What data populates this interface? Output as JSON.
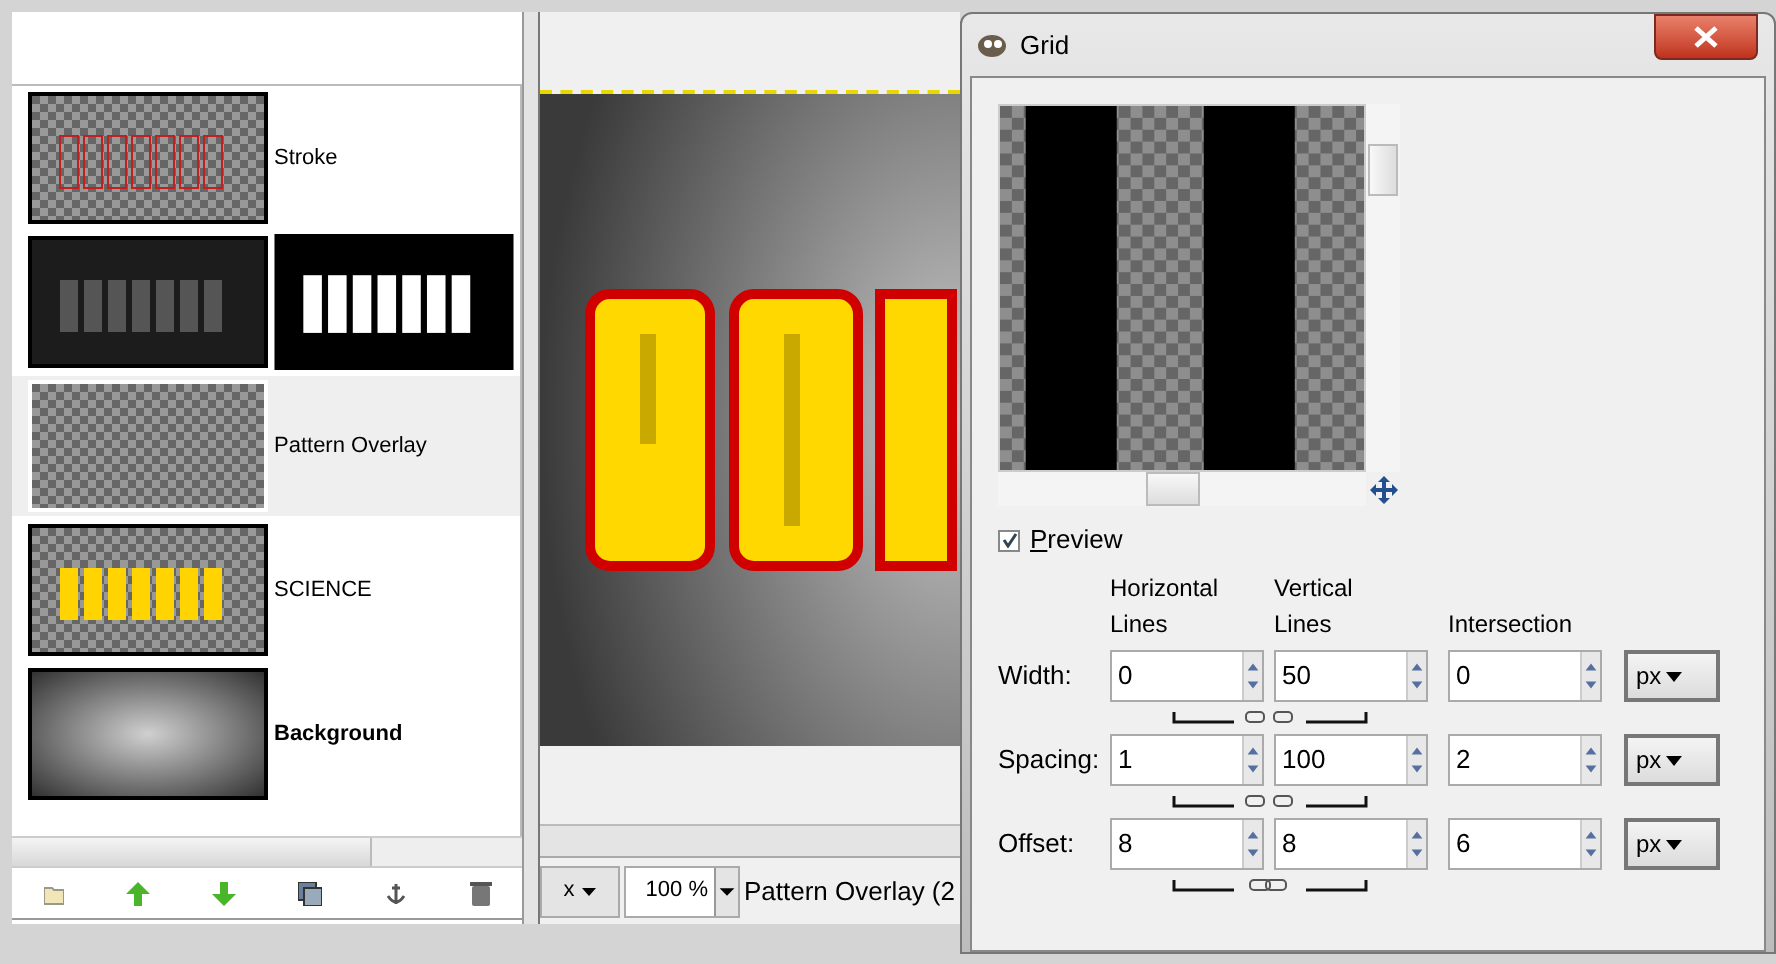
{
  "layers": [
    {
      "name": "Stroke",
      "kind": "stroke",
      "selected": false
    },
    {
      "kind": "effect",
      "selected": false
    },
    {
      "name": "Pattern Overlay",
      "kind": "pattern",
      "selected": true
    },
    {
      "name": "SCIENCE",
      "kind": "text",
      "selected": false
    },
    {
      "name": "Background",
      "kind": "gradient",
      "selected": false,
      "emphasized": true
    }
  ],
  "status_bar": {
    "unit": "x",
    "zoom": "100 %",
    "message": "Pattern Overlay (2"
  },
  "dialog": {
    "title": "Grid",
    "preview": {
      "label": "Preview",
      "checked": true
    },
    "columns": [
      "Horizontal Lines",
      "Vertical Lines",
      "Intersection"
    ],
    "rows": [
      {
        "label": "Width:",
        "values": [
          "0",
          "50",
          "0"
        ],
        "unit": "px",
        "linked": false
      },
      {
        "label": "Spacing:",
        "values": [
          "1",
          "100",
          "2"
        ],
        "unit": "px",
        "linked": false
      },
      {
        "label": "Offset:",
        "values": [
          "8",
          "8",
          "6"
        ],
        "unit": "px",
        "linked": true
      }
    ]
  }
}
